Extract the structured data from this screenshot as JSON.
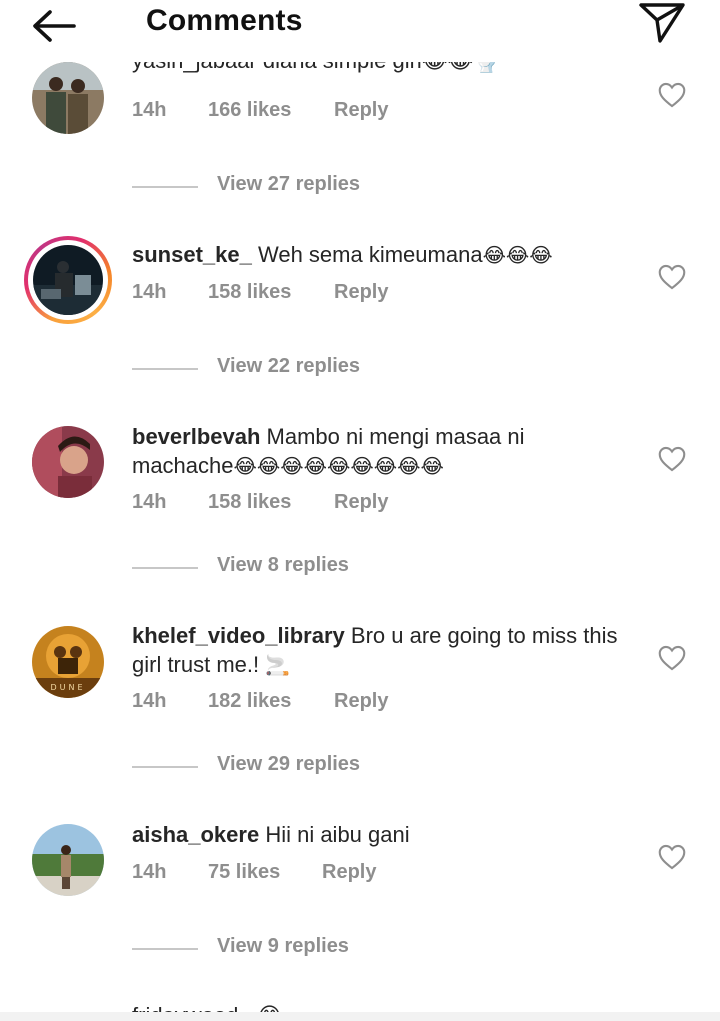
{
  "header": {
    "title": "Comments",
    "back_icon": "arrow-left-icon",
    "send_icon": "paper-plane-icon"
  },
  "partial_top_comment": {
    "text": "yasin_jabaar diana simple girl😂😂🚽",
    "time": "14h",
    "likes": "166 likes",
    "reply": "Reply",
    "view_replies": "View 27 replies"
  },
  "comments": [
    {
      "username": "sunset_ke_",
      "text": " Weh sema kimeumana",
      "emoji": "😂😂😂",
      "time": "14h",
      "likes": "158 likes",
      "reply": "Reply",
      "view_replies": "View 22 replies",
      "has_story": true
    },
    {
      "username": "beverlbevah",
      "text": " Mambo ni mengi masaa ni machache",
      "emoji": "😂😂😂😂😂😂😂😂😂",
      "time": "14h",
      "likes": "158 likes",
      "reply": "Reply",
      "view_replies": "View 8 replies",
      "has_story": false
    },
    {
      "username": "khelef_video_library",
      "text": " Bro u are going to miss this girl trust me.! ",
      "emoji": "🚬",
      "time": "14h",
      "likes": "182 likes",
      "reply": "Reply",
      "view_replies": "View 29 replies",
      "has_story": false,
      "avatar_text": "DUNE"
    },
    {
      "username": "aisha_okere",
      "text": " Hii ni aibu gani",
      "emoji": "",
      "time": "14h",
      "likes": "75 likes",
      "reply": "Reply",
      "view_replies": "View 9 replies",
      "has_story": false
    }
  ],
  "partial_bottom_comment": {
    "text": "fridaywood_ 😂 ..."
  },
  "colors": {
    "text_primary": "#262626",
    "text_secondary": "#8e8e8e",
    "divider": "#c7c7c7",
    "story_ring_start": "#fcaf45",
    "story_ring_end": "#e1306c"
  }
}
